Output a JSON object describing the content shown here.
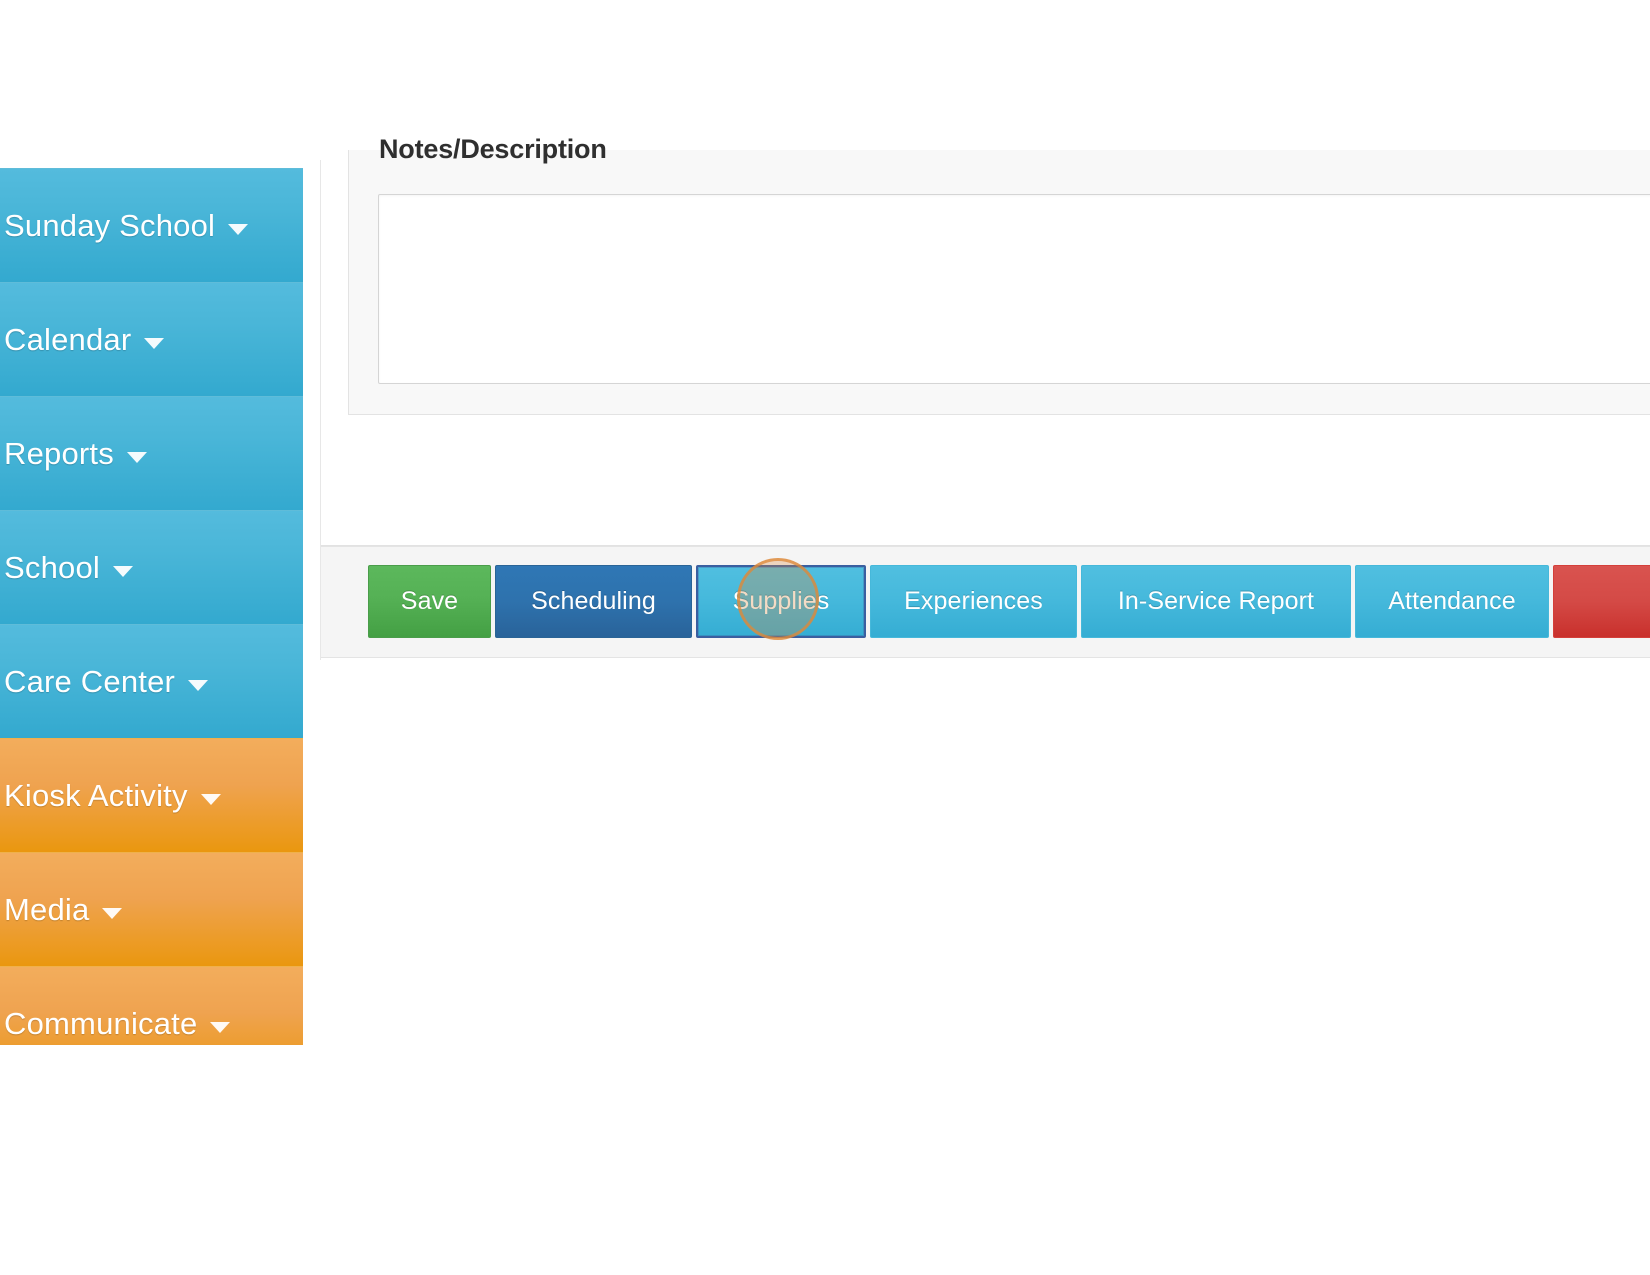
{
  "sidebar": {
    "items": [
      {
        "label": "Sunday School",
        "color_group": "blue",
        "caret": "caret-down-icon"
      },
      {
        "label": "Calendar",
        "color_group": "blue",
        "caret": "caret-down-icon"
      },
      {
        "label": "Reports",
        "color_group": "blue",
        "caret": "caret-down-icon"
      },
      {
        "label": "School",
        "color_group": "blue",
        "caret": "caret-down-icon"
      },
      {
        "label": "Care Center",
        "color_group": "blue",
        "caret": "caret-down-icon"
      },
      {
        "label": "Kiosk Activity",
        "color_group": "orange",
        "caret": "caret-down-icon"
      },
      {
        "label": "Media",
        "color_group": "orange",
        "caret": "caret-down-icon"
      },
      {
        "label": "Communicate",
        "color_group": "orange",
        "caret": "caret-down-icon"
      }
    ],
    "colors": {
      "blue": "#44b3d6",
      "orange": "#efa351"
    }
  },
  "notes": {
    "label": "Notes/Description",
    "value": "",
    "placeholder": ""
  },
  "footer": {
    "buttons": [
      {
        "label": "Save",
        "style": "save"
      },
      {
        "label": "Scheduling",
        "style": "scheduling"
      },
      {
        "label": "Supplies",
        "style": "supplies"
      },
      {
        "label": "Experiences",
        "style": "experiences"
      },
      {
        "label": "In-Service Report",
        "style": "inservice"
      },
      {
        "label": "Attendance",
        "style": "attendance"
      },
      {
        "label": "",
        "style": "danger"
      }
    ],
    "colors": {
      "save": "#5cb85c",
      "scheduling": "#2f77b5",
      "info": "#46b8da",
      "danger": "#d9534f",
      "focus_outline": "#3a5fa0"
    }
  },
  "cursor": {
    "target": "Supplies",
    "highlight_color": "#d8893e"
  }
}
